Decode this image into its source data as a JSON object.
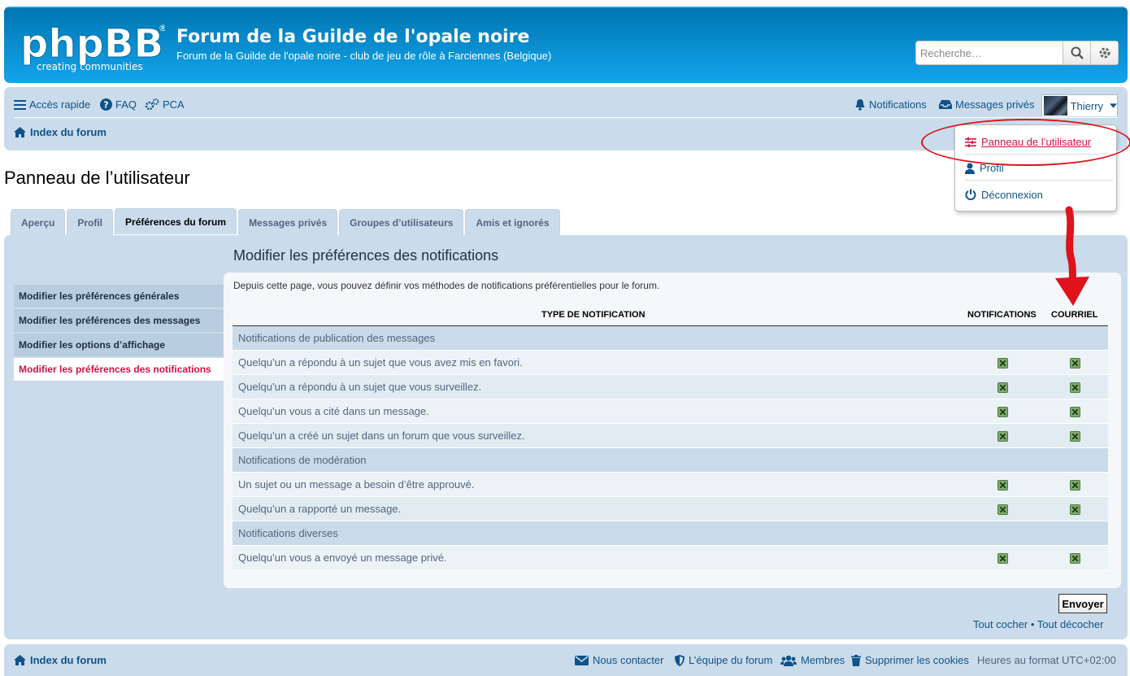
{
  "header": {
    "logo_text": "phpBB",
    "logo_tagline": "creating communities",
    "site_title": "Forum de la Guilde de l'opale noire",
    "site_description": "Forum de la Guilde de l'opale noire - club de jeu de rôle à Farciennes (Belgique)",
    "search_placeholder": "Recherche…"
  },
  "nav": {
    "quick_access": "Accès rapide",
    "faq": "FAQ",
    "acp": "PCA",
    "notifications": "Notifications",
    "private_messages": "Messages privés",
    "username": "Thierry",
    "breadcrumb": "Index du forum"
  },
  "dropdown": {
    "items": [
      "Panneau de l’utilisateur",
      "Profil",
      "Déconnexion"
    ]
  },
  "page_title": "Panneau de l’utilisateur",
  "tabs": [
    "Aperçu",
    "Profil",
    "Préférences du forum",
    "Messages privés",
    "Groupes d’utilisateurs",
    "Amis et ignorés"
  ],
  "active_tab": "Préférences du forum",
  "side_menu": [
    "Modifier les préférences générales",
    "Modifier les préférences des messages",
    "Modifier les options d’affichage",
    "Modifier les préférences des notifications"
  ],
  "content": {
    "title": "Modifier les préférences des notifications",
    "intro": "Depuis cette page, vous pouvez définir vos méthodes de notifications préférentielles pour le forum.",
    "columns": [
      "TYPE DE NOTIFICATION",
      "NOTIFICATIONS",
      "COURRIEL"
    ],
    "rows": [
      {
        "label": "Notifications de publication des messages",
        "section": true
      },
      {
        "label": "Quelqu’un a répondu à un sujet que vous avez mis en favori.",
        "section": false
      },
      {
        "label": "Quelqu’un a répondu à un sujet que vous surveillez.",
        "section": false
      },
      {
        "label": "Quelqu’un vous a cité dans un message.",
        "section": false
      },
      {
        "label": "Quelqu’un a créé un sujet dans un forum que vous surveillez.",
        "section": false
      },
      {
        "label": "Notifications de modération",
        "section": true
      },
      {
        "label": "Un sujet ou un message a besoin d’être approuvé.",
        "section": false
      },
      {
        "label": "Quelqu’un a rapporté un message.",
        "section": false
      },
      {
        "label": "Notifications diverses",
        "section": true
      },
      {
        "label": "Quelqu’un vous a envoyé un message privé.",
        "section": false
      }
    ],
    "submit": "Envoyer",
    "check_all": "Tout cocher",
    "separator": "•",
    "uncheck_all": "Tout décocher"
  },
  "footer": {
    "index": "Index du forum",
    "contact": "Nous contacter",
    "team": "L’équipe du forum",
    "members": "Membres",
    "delete_cookies": "Supprimer les cookies",
    "timezone": "Heures au format UTC+02:00"
  },
  "colors": {
    "header_blue": "#12A3EB",
    "panel_bg": "#cadceb",
    "link": "#105289",
    "active_red": "#d31141",
    "annotation_red": "#e0121b"
  }
}
